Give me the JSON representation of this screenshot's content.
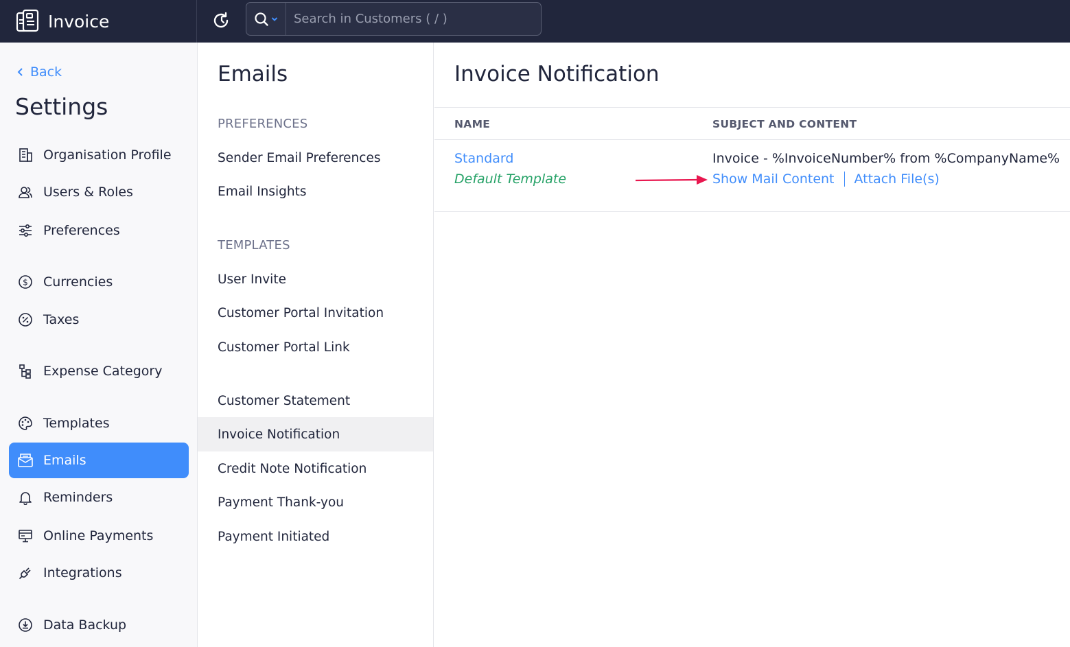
{
  "app": {
    "name": "Invoice"
  },
  "search": {
    "placeholder": "Search in Customers ( / )"
  },
  "sidebar": {
    "back_label": "Back",
    "title": "Settings",
    "items": [
      {
        "label": "Organisation Profile",
        "icon": "building-icon"
      },
      {
        "label": "Users & Roles",
        "icon": "users-icon"
      },
      {
        "label": "Preferences",
        "icon": "sliders-icon"
      },
      {
        "label": "Currencies",
        "icon": "currency-icon"
      },
      {
        "label": "Taxes",
        "icon": "percent-icon"
      },
      {
        "label": "Expense Category",
        "icon": "hierarchy-icon"
      },
      {
        "label": "Templates",
        "icon": "palette-icon"
      },
      {
        "label": "Emails",
        "icon": "envelope-icon",
        "active": true
      },
      {
        "label": "Reminders",
        "icon": "bell-icon"
      },
      {
        "label": "Online Payments",
        "icon": "payment-icon"
      },
      {
        "label": "Integrations",
        "icon": "plug-icon"
      },
      {
        "label": "Data Backup",
        "icon": "backup-icon"
      }
    ]
  },
  "emails": {
    "title": "Emails",
    "preferences_label": "PREFERENCES",
    "preferences": [
      "Sender Email Preferences",
      "Email Insights"
    ],
    "templates_label": "TEMPLATES",
    "templates": [
      "User Invite",
      "Customer Portal Invitation",
      "Customer Portal Link",
      "Customer Statement",
      "Invoice Notification",
      "Credit Note Notification",
      "Payment Thank-you",
      "Payment Initiated"
    ],
    "active_template": "Invoice Notification"
  },
  "content": {
    "title": "Invoice Notification",
    "columns": {
      "name": "NAME",
      "subject": "SUBJECT AND CONTENT"
    },
    "row": {
      "name": "Standard",
      "default_label": "Default Template",
      "subject": "Invoice - %InvoiceNumber% from %CompanyName%",
      "show_mail": "Show Mail Content",
      "attach": "Attach File(s)"
    }
  },
  "colors": {
    "topbar": "#21263c",
    "accent": "#408dfb",
    "default_green": "#26a267",
    "arrow": "#e8174f"
  }
}
